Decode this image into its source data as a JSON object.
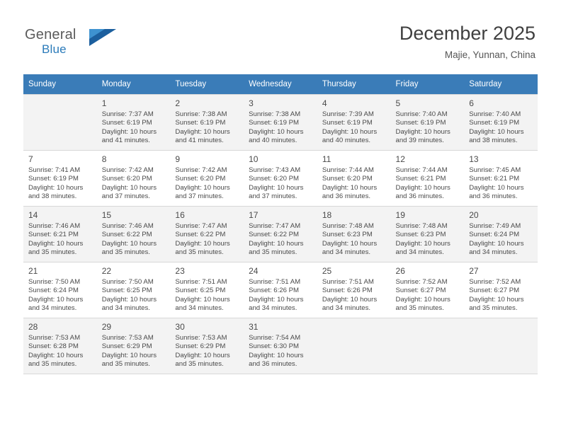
{
  "brand": {
    "word_general": "General",
    "word_blue": "Blue",
    "flag_icon": "flag-icon"
  },
  "header": {
    "title": "December 2025",
    "location": "Majie, Yunnan, China"
  },
  "calendar": {
    "weekday_headers": [
      "Sunday",
      "Monday",
      "Tuesday",
      "Wednesday",
      "Thursday",
      "Friday",
      "Saturday"
    ],
    "weeks": [
      [
        {
          "day": "",
          "lines": []
        },
        {
          "day": "1",
          "lines": [
            "Sunrise: 7:37 AM",
            "Sunset: 6:19 PM",
            "Daylight: 10 hours",
            "and 41 minutes."
          ]
        },
        {
          "day": "2",
          "lines": [
            "Sunrise: 7:38 AM",
            "Sunset: 6:19 PM",
            "Daylight: 10 hours",
            "and 41 minutes."
          ]
        },
        {
          "day": "3",
          "lines": [
            "Sunrise: 7:38 AM",
            "Sunset: 6:19 PM",
            "Daylight: 10 hours",
            "and 40 minutes."
          ]
        },
        {
          "day": "4",
          "lines": [
            "Sunrise: 7:39 AM",
            "Sunset: 6:19 PM",
            "Daylight: 10 hours",
            "and 40 minutes."
          ]
        },
        {
          "day": "5",
          "lines": [
            "Sunrise: 7:40 AM",
            "Sunset: 6:19 PM",
            "Daylight: 10 hours",
            "and 39 minutes."
          ]
        },
        {
          "day": "6",
          "lines": [
            "Sunrise: 7:40 AM",
            "Sunset: 6:19 PM",
            "Daylight: 10 hours",
            "and 38 minutes."
          ]
        }
      ],
      [
        {
          "day": "7",
          "lines": [
            "Sunrise: 7:41 AM",
            "Sunset: 6:19 PM",
            "Daylight: 10 hours",
            "and 38 minutes."
          ]
        },
        {
          "day": "8",
          "lines": [
            "Sunrise: 7:42 AM",
            "Sunset: 6:20 PM",
            "Daylight: 10 hours",
            "and 37 minutes."
          ]
        },
        {
          "day": "9",
          "lines": [
            "Sunrise: 7:42 AM",
            "Sunset: 6:20 PM",
            "Daylight: 10 hours",
            "and 37 minutes."
          ]
        },
        {
          "day": "10",
          "lines": [
            "Sunrise: 7:43 AM",
            "Sunset: 6:20 PM",
            "Daylight: 10 hours",
            "and 37 minutes."
          ]
        },
        {
          "day": "11",
          "lines": [
            "Sunrise: 7:44 AM",
            "Sunset: 6:20 PM",
            "Daylight: 10 hours",
            "and 36 minutes."
          ]
        },
        {
          "day": "12",
          "lines": [
            "Sunrise: 7:44 AM",
            "Sunset: 6:21 PM",
            "Daylight: 10 hours",
            "and 36 minutes."
          ]
        },
        {
          "day": "13",
          "lines": [
            "Sunrise: 7:45 AM",
            "Sunset: 6:21 PM",
            "Daylight: 10 hours",
            "and 36 minutes."
          ]
        }
      ],
      [
        {
          "day": "14",
          "lines": [
            "Sunrise: 7:46 AM",
            "Sunset: 6:21 PM",
            "Daylight: 10 hours",
            "and 35 minutes."
          ]
        },
        {
          "day": "15",
          "lines": [
            "Sunrise: 7:46 AM",
            "Sunset: 6:22 PM",
            "Daylight: 10 hours",
            "and 35 minutes."
          ]
        },
        {
          "day": "16",
          "lines": [
            "Sunrise: 7:47 AM",
            "Sunset: 6:22 PM",
            "Daylight: 10 hours",
            "and 35 minutes."
          ]
        },
        {
          "day": "17",
          "lines": [
            "Sunrise: 7:47 AM",
            "Sunset: 6:22 PM",
            "Daylight: 10 hours",
            "and 35 minutes."
          ]
        },
        {
          "day": "18",
          "lines": [
            "Sunrise: 7:48 AM",
            "Sunset: 6:23 PM",
            "Daylight: 10 hours",
            "and 34 minutes."
          ]
        },
        {
          "day": "19",
          "lines": [
            "Sunrise: 7:48 AM",
            "Sunset: 6:23 PM",
            "Daylight: 10 hours",
            "and 34 minutes."
          ]
        },
        {
          "day": "20",
          "lines": [
            "Sunrise: 7:49 AM",
            "Sunset: 6:24 PM",
            "Daylight: 10 hours",
            "and 34 minutes."
          ]
        }
      ],
      [
        {
          "day": "21",
          "lines": [
            "Sunrise: 7:50 AM",
            "Sunset: 6:24 PM",
            "Daylight: 10 hours",
            "and 34 minutes."
          ]
        },
        {
          "day": "22",
          "lines": [
            "Sunrise: 7:50 AM",
            "Sunset: 6:25 PM",
            "Daylight: 10 hours",
            "and 34 minutes."
          ]
        },
        {
          "day": "23",
          "lines": [
            "Sunrise: 7:51 AM",
            "Sunset: 6:25 PM",
            "Daylight: 10 hours",
            "and 34 minutes."
          ]
        },
        {
          "day": "24",
          "lines": [
            "Sunrise: 7:51 AM",
            "Sunset: 6:26 PM",
            "Daylight: 10 hours",
            "and 34 minutes."
          ]
        },
        {
          "day": "25",
          "lines": [
            "Sunrise: 7:51 AM",
            "Sunset: 6:26 PM",
            "Daylight: 10 hours",
            "and 34 minutes."
          ]
        },
        {
          "day": "26",
          "lines": [
            "Sunrise: 7:52 AM",
            "Sunset: 6:27 PM",
            "Daylight: 10 hours",
            "and 35 minutes."
          ]
        },
        {
          "day": "27",
          "lines": [
            "Sunrise: 7:52 AM",
            "Sunset: 6:27 PM",
            "Daylight: 10 hours",
            "and 35 minutes."
          ]
        }
      ],
      [
        {
          "day": "28",
          "lines": [
            "Sunrise: 7:53 AM",
            "Sunset: 6:28 PM",
            "Daylight: 10 hours",
            "and 35 minutes."
          ]
        },
        {
          "day": "29",
          "lines": [
            "Sunrise: 7:53 AM",
            "Sunset: 6:29 PM",
            "Daylight: 10 hours",
            "and 35 minutes."
          ]
        },
        {
          "day": "30",
          "lines": [
            "Sunrise: 7:53 AM",
            "Sunset: 6:29 PM",
            "Daylight: 10 hours",
            "and 35 minutes."
          ]
        },
        {
          "day": "31",
          "lines": [
            "Sunrise: 7:54 AM",
            "Sunset: 6:30 PM",
            "Daylight: 10 hours",
            "and 36 minutes."
          ]
        },
        {
          "day": "",
          "lines": []
        },
        {
          "day": "",
          "lines": []
        },
        {
          "day": "",
          "lines": []
        }
      ]
    ]
  },
  "colors": {
    "header_band": "#3a7cb8",
    "brand_blue": "#2b7bba",
    "alt_row": "#f3f3f3"
  }
}
